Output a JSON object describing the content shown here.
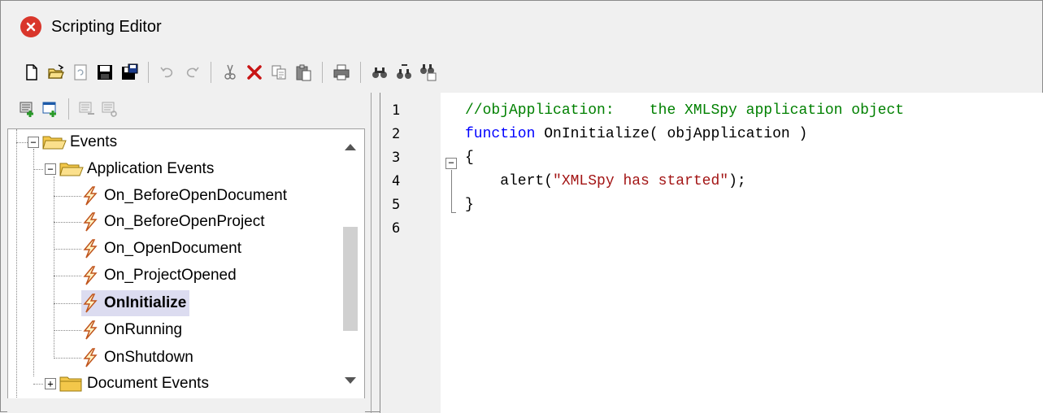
{
  "window": {
    "title": "Scripting Editor",
    "accent": "#d9362b"
  },
  "toolbar": {
    "groups": [
      [
        "new-icon",
        "open-icon",
        "reload-icon",
        "save-icon",
        "save-all-icon"
      ],
      [
        "undo-icon",
        "redo-icon"
      ],
      [
        "cut-icon",
        "delete-icon",
        "copy-icon",
        "paste-icon"
      ],
      [
        "print-icon"
      ],
      [
        "find-icon",
        "find-next-icon",
        "replace-icon"
      ]
    ]
  },
  "project_toolbar": {
    "items": [
      "add-macro-icon",
      "add-form-icon",
      "remove-icon",
      "properties-icon"
    ]
  },
  "tree": {
    "root": "Events",
    "application_events": "Application Events",
    "events": [
      "On_BeforeOpenDocument",
      "On_BeforeOpenProject",
      "On_OpenDocument",
      "On_ProjectOpened",
      "OnInitialize",
      "OnRunning",
      "OnShutdown"
    ],
    "selected_event": "OnInitialize",
    "document_events": "Document Events"
  },
  "editor": {
    "line_numbers": [
      "1",
      "2",
      "3",
      "4",
      "5",
      "6"
    ],
    "line1_comment": "//objApplication:    the XMLSpy application object",
    "line2_keyword": "function",
    "line2_rest": " OnInitialize( objApplication )",
    "line3": "{",
    "line4_pre": "    alert(",
    "line4_string": "\"XMLSpy has started\"",
    "line4_post": ");",
    "line5": "}",
    "colors": {
      "comment": "#008000",
      "keyword": "#0000ff",
      "string": "#a31515"
    }
  }
}
